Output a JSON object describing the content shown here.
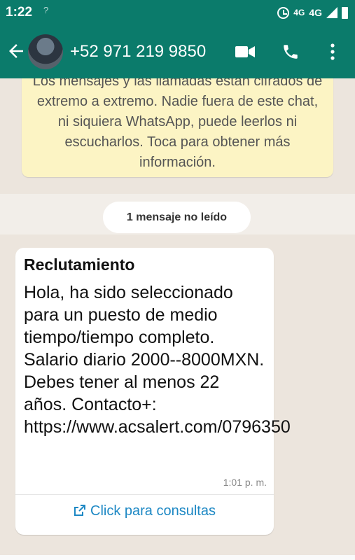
{
  "status_bar": {
    "time": "1:22",
    "signal_left": "?",
    "network": "4G",
    "network_small": "4G"
  },
  "header": {
    "contact": "+52 971 219 9850",
    "icons": [
      "back-arrow-icon",
      "avatar",
      "video-call-icon",
      "phone-icon",
      "more-vert-icon"
    ]
  },
  "chat": {
    "encryption_notice": "Los mensajes y las llamadas están cifrados de extremo a extremo. Nadie fuera de este chat, ni siquiera WhatsApp, puede leerlos ni escucharlos. Toca para obtener más información.",
    "unread_label": "1 mensaje no leído",
    "message": {
      "sender": "Reclutamiento",
      "body": "Hola, ha sido seleccionado para un puesto de medio tiempo/tiempo completo. Salario diario 2000--8000MXN. Debes tener al menos 22 años. Contacto+: https://www.acsalert.com/0796350",
      "time": "1:01 p. m.",
      "link_label": "Click para consultas"
    }
  },
  "colors": {
    "header": "#0b7b6b",
    "chat_bg": "#ece5dd",
    "notice_bg": "#fcf4c4",
    "link": "#1d88c4"
  }
}
